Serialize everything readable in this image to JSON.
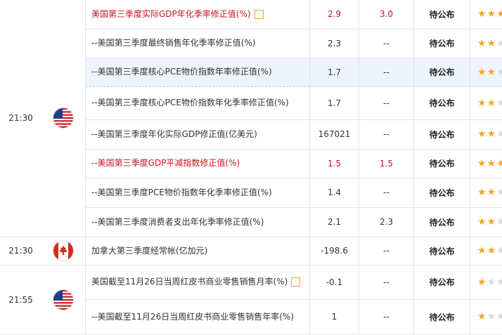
{
  "colors": {
    "accent_red": "#c8161d",
    "star_on": "#f5a623",
    "star_off": "#d8d8d8",
    "highlight_row": "#eef4fc"
  },
  "rows": [
    {
      "time": "21:30",
      "country": "US",
      "name": "美国第三季度实际GDP年化季率修正值(%)",
      "note_icon": "-",
      "prev": "2.9",
      "forecast": "3.0",
      "actual": "待公布",
      "stars": 3,
      "red": true
    },
    {
      "name": "--美国第三季度最终销售年化季率修正值(%)",
      "prev": "2.3",
      "forecast": "--",
      "actual": "待公布",
      "stars": 2
    },
    {
      "name": "--美国第三季度核心PCE物价指数年率修正值(%)",
      "prev": "1.7",
      "forecast": "--",
      "actual": "待公布",
      "stars": 2,
      "highlight": true
    },
    {
      "name": "--美国第三季度核心PCE物价指数年化季率修正值(%)",
      "prev": "1.7",
      "forecast": "--",
      "actual": "待公布",
      "stars": 2
    },
    {
      "name": "--美国第三季度年化实际GDP修正值(亿美元)",
      "prev": "167021",
      "forecast": "--",
      "actual": "待公布",
      "stars": 2
    },
    {
      "name": "--美国第三季度GDP平减指数修正值(%)",
      "prev": "1.5",
      "forecast": "1.5",
      "actual": "待公布",
      "stars": 3,
      "red": true
    },
    {
      "name": "--美国第三季度PCE物价指数年化季率修正值(%)",
      "prev": "1.4",
      "forecast": "--",
      "actual": "待公布",
      "stars": 2
    },
    {
      "name": "--美国第三季度消费者支出年化季率修正值(%)",
      "prev": "2.1",
      "forecast": "2.3",
      "actual": "待公布",
      "stars": 2
    },
    {
      "time": "21:30",
      "country": "CA",
      "name": "加拿大第三季度经常帐(亿加元)",
      "prev": "-198.6",
      "forecast": "--",
      "actual": "待公布",
      "stars": 2
    },
    {
      "time": "21:55",
      "country": "US",
      "name": "美国截至11月26日当周红皮书商业零售销售月率(%)",
      "note_icon": "-",
      "prev": "-0.1",
      "forecast": "--",
      "actual": "待公布",
      "stars": 1
    },
    {
      "name": "--美国截至11月26日当周红皮书商业零售销售年率(%)",
      "prev": "1",
      "forecast": "--",
      "actual": "待公布",
      "stars": 1
    }
  ]
}
